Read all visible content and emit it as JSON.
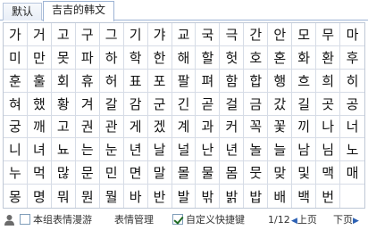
{
  "tabs": [
    {
      "label": "默认",
      "active": false
    },
    {
      "label": "吉吉的韩文",
      "active": true
    }
  ],
  "grid": {
    "rows": [
      [
        "가",
        "거",
        "고",
        "구",
        "그",
        "기",
        "갸",
        "교",
        "국",
        "극",
        "간",
        "안",
        "모",
        "무",
        "마"
      ],
      [
        "미",
        "만",
        "못",
        "파",
        "하",
        "학",
        "한",
        "해",
        "할",
        "헛",
        "호",
        "혼",
        "화",
        "환",
        "후"
      ],
      [
        "훈",
        "훌",
        "회",
        "휴",
        "허",
        "표",
        "포",
        "팔",
        "펴",
        "함",
        "합",
        "행",
        "흐",
        "희",
        "히"
      ],
      [
        "혀",
        "했",
        "황",
        "겨",
        "갈",
        "감",
        "군",
        "긴",
        "곧",
        "걸",
        "금",
        "갔",
        "길",
        "곳",
        "공"
      ],
      [
        "궁",
        "깨",
        "고",
        "권",
        "관",
        "게",
        "겠",
        "계",
        "과",
        "커",
        "꼭",
        "꽃",
        "끼",
        "나",
        "너"
      ],
      [
        "니",
        "녀",
        "뇨",
        "는",
        "눈",
        "년",
        "날",
        "널",
        "난",
        "년",
        "놀",
        "늘",
        "남",
        "님",
        "노"
      ],
      [
        "누",
        "먹",
        "많",
        "문",
        "민",
        "면",
        "말",
        "몰",
        "물",
        "몸",
        "뭇",
        "맞",
        "및",
        "맥",
        "매"
      ],
      [
        "몽",
        "명",
        "뭐",
        "뭔",
        "뭘",
        "바",
        "반",
        "발",
        "밖",
        "밝",
        "밥",
        "배",
        "백",
        "번",
        ""
      ]
    ]
  },
  "footer": {
    "roaming_label": "本组表情漫游",
    "roaming_checked": false,
    "manage_label": "表情管理",
    "shortcut_label": "自定义快捷键",
    "shortcut_checked": true,
    "page_indicator": "1/12",
    "prev_label": "上页",
    "next_label": "下页"
  },
  "colors": {
    "accent": "#2d61b3",
    "tab_border": "#9db3d4",
    "grid_line": "#d6dce6"
  },
  "icons": [
    "person-icon",
    "triangle-left-icon",
    "triangle-right-icon"
  ]
}
